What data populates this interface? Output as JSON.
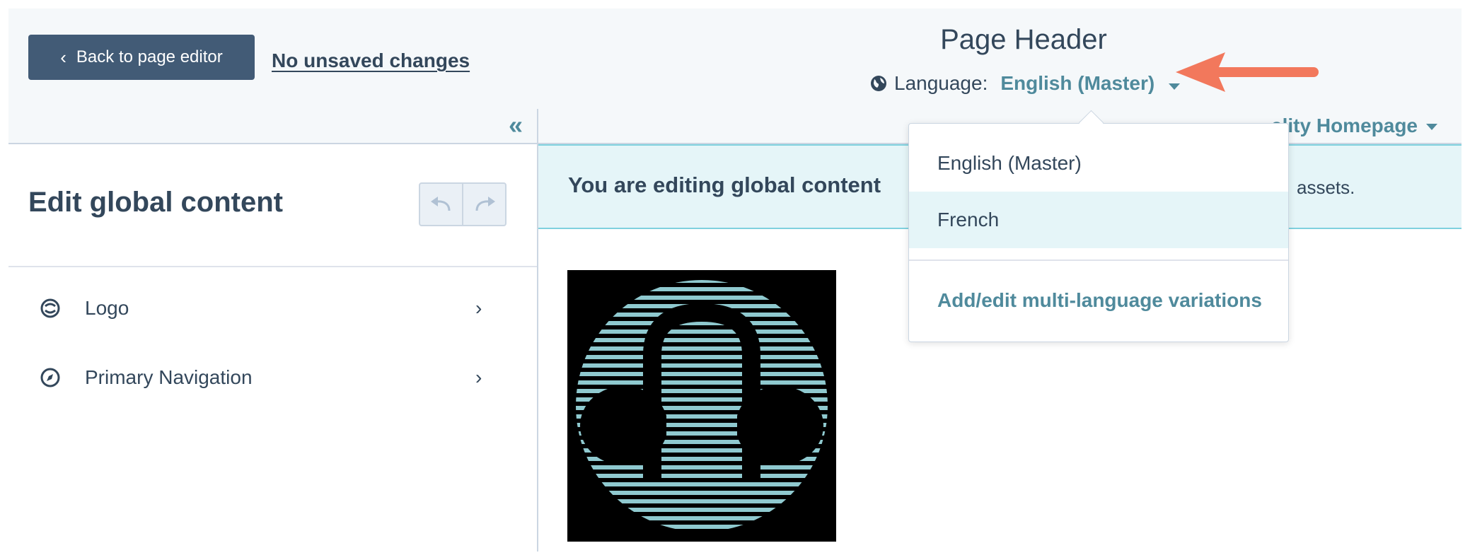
{
  "header": {
    "back_label": "Back to page editor",
    "save_status": "No unsaved changes",
    "title": "Page Header",
    "language_label": "Language:",
    "language_value": "English (Master)"
  },
  "sidebar": {
    "title": "Edit global content",
    "items": [
      {
        "label": "Logo",
        "icon": "logo-module-icon"
      },
      {
        "label": "Primary Navigation",
        "icon": "compass-icon"
      }
    ]
  },
  "main": {
    "page_selector": "ality Homepage",
    "banner_text": "You are editing global content",
    "banner_tail": "assets."
  },
  "dropdown": {
    "options": [
      "English (Master)",
      "French"
    ],
    "highlighted": "French",
    "link": "Add/edit multi-language variations"
  },
  "colors": {
    "accent": "#4f8a9c",
    "button": "#425b76",
    "banner": "#e5f5f8",
    "annotation_arrow": "#f2785c"
  }
}
